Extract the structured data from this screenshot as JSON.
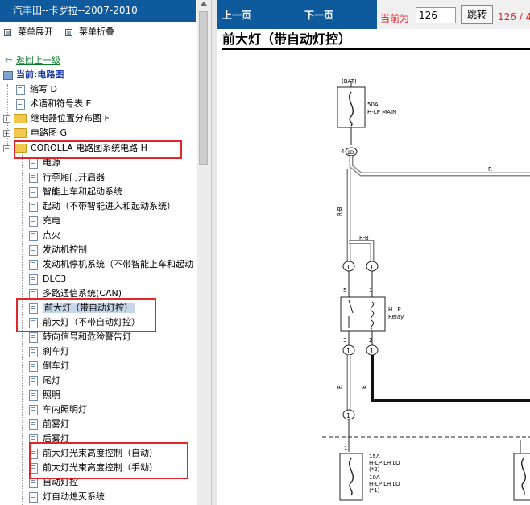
{
  "left": {
    "title": "一汽丰田--卡罗拉--2007-2010",
    "expand_label": "菜单展开",
    "collapse_label": "菜单折叠",
    "back_label": "返回上一级",
    "current_label": "当前:电路图",
    "top_items": [
      {
        "label": "缩写 D",
        "type": "doc"
      },
      {
        "label": "术语和符号表 E",
        "type": "doc"
      },
      {
        "label": "继电器位置分布图 F",
        "type": "folder"
      },
      {
        "label": "电路图 G",
        "type": "folder"
      },
      {
        "label": "COROLLA 电路图系统电路 H",
        "type": "folder-open"
      }
    ],
    "sub_items": [
      "电源",
      "行李厢门开启器",
      "智能上车和起动系统",
      "起动（不带智能进入和起动系统）",
      "充电",
      "点火",
      "发动机控制",
      "发动机停机系统（不带智能上车和起动",
      "DLC3",
      "多路通信系统(CAN)",
      "前大灯（带自动灯控）",
      "前大灯（不带自动灯控）",
      "转向信号和危险警告灯",
      "刹车灯",
      "倒车灯",
      "尾灯",
      "照明",
      "车内照明灯",
      "前雾灯",
      "后雾灯",
      "前大灯光束高度控制（自动）",
      "前大灯光束高度控制（手动）",
      "自动灯控",
      "灯自动熄灭系统"
    ]
  },
  "toolbar": {
    "prev_label": "上一页",
    "next_label": "下一页",
    "current_prefix": "当前为",
    "current_page": "126",
    "jump_label": "跳转",
    "pages_text": "126 / 4"
  },
  "page": {
    "title": "前大灯（带自动灯控）"
  },
  "diagram": {
    "bat": "(BAT)",
    "fuse_main_amp": "50A",
    "fuse_main_name": "H-LP MAIN",
    "conn_1d": "1D",
    "pin_4": "4",
    "wire_r": "R",
    "wire_rb": "R-B",
    "wire_rb2": "R-B",
    "relay_name": "H LP",
    "relay_sub": "Relay",
    "pin5": "5",
    "pin1": "1",
    "pin3": "3",
    "pin2": "2",
    "wire_r2": "R",
    "wire_b": "B",
    "conn_1": "1",
    "pin_1b": "1",
    "fuse_15a": "15A",
    "fuse_15a_name": "H-LP LH LO",
    "fuse_15a_note": "(*2)",
    "fuse_10a": "10A",
    "fuse_10a_name": "H-LP LH LO",
    "fuse_10a_note": "(*1)"
  }
}
